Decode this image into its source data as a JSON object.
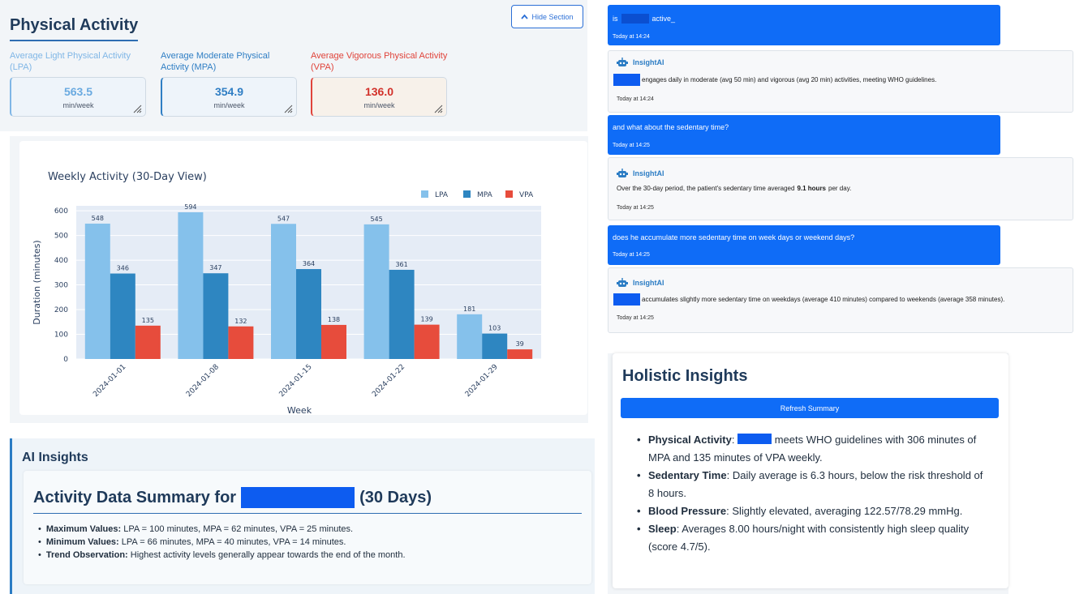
{
  "physical_activity": {
    "title": "Physical Activity",
    "hide_button": "Hide Section",
    "metrics": [
      {
        "label": "Average Light Physical Activity (LPA)",
        "value": "563.5",
        "unit": "min/week",
        "color": "#7fb6e6"
      },
      {
        "label": "Average Moderate Physical Activity (MPA)",
        "value": "354.9",
        "unit": "min/week",
        "color": "#2f7ec4"
      },
      {
        "label": "Average Vigorous Physical Activity (VPA)",
        "value": "136.0",
        "unit": "min/week",
        "color": "#e0433a"
      }
    ]
  },
  "chart_data": {
    "type": "bar",
    "title": "Weekly Activity (30-Day View)",
    "xlabel": "Week",
    "ylabel": "Duration (minutes)",
    "categories": [
      "2024-01-01",
      "2024-01-08",
      "2024-01-15",
      "2024-01-22",
      "2024-01-29"
    ],
    "series": [
      {
        "name": "LPA",
        "color": "#85c1eb",
        "values": [
          548,
          594,
          547,
          545,
          181
        ]
      },
      {
        "name": "MPA",
        "color": "#2e86c1",
        "values": [
          346,
          347,
          364,
          361,
          103
        ]
      },
      {
        "name": "VPA",
        "color": "#e74c3c",
        "values": [
          135,
          132,
          138,
          139,
          39
        ]
      }
    ],
    "yticks": [
      0,
      100,
      200,
      300,
      400,
      500,
      600
    ],
    "ylim": [
      0,
      620
    ],
    "legend": "top-right",
    "grid": true
  },
  "ai_insights": {
    "title": "AI Insights",
    "summary_prefix": "Activity Data Summary for",
    "summary_suffix": "(30 Days)",
    "items": [
      {
        "label": "Maximum Values:",
        "text": "LPA = 100 minutes, MPA = 62 minutes, VPA = 25 minutes."
      },
      {
        "label": "Minimum Values:",
        "text": "LPA = 66 minutes, MPA = 40 minutes, VPA = 14 minutes."
      },
      {
        "label": "Trend Observation:",
        "text": "Highest activity levels generally appear towards the end of the month."
      }
    ]
  },
  "chat": {
    "bot_name": "InsightAI",
    "messages": [
      {
        "role": "user",
        "pre": "is",
        "post": "active_",
        "time": "Today at 14:24"
      },
      {
        "role": "bot",
        "text": "engages daily in moderate (avg 50 min) and vigorous (avg 20 min) activities, meeting WHO guidelines.",
        "time": "Today at 14:24"
      },
      {
        "role": "user",
        "text": "and what about the sedentary time?",
        "time": "Today at 14:25"
      },
      {
        "role": "bot",
        "text_pre": "Over the 30-day period, the patient's sedentary time averaged",
        "text_bold": "9.1 hours",
        "text_post": "per day.",
        "time": "Today at 14:25"
      },
      {
        "role": "user",
        "text": "does he accumulate more sedentary time on week days or weekend days?",
        "time": "Today at 14:25"
      },
      {
        "role": "bot",
        "text": "accumulates slightly more sedentary time on weekdays (average 410 minutes) compared to weekends (average 358 minutes).",
        "time": "Today at 14:25"
      }
    ]
  },
  "holistic": {
    "title": "Holistic Insights",
    "refresh_button": "Refresh Summary",
    "items": [
      {
        "label": "Physical Activity",
        "text": "meets WHO guidelines with 306 minutes of MPA and 135 minutes of VPA weekly."
      },
      {
        "label": "Sedentary Time",
        "text": "Daily average is 6.3 hours, below the risk threshold of 8 hours."
      },
      {
        "label": "Blood Pressure",
        "text": "Slightly elevated, averaging 122.57/78.29 mmHg."
      },
      {
        "label": "Sleep",
        "text": "Averages 8.00 hours/night with consistently high sleep quality (score 4.7/5)."
      }
    ]
  }
}
